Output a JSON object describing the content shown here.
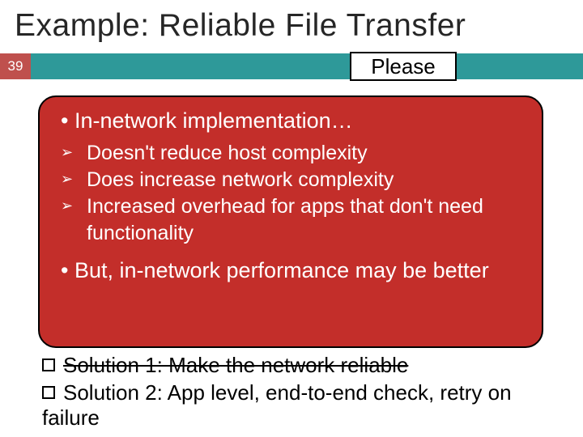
{
  "title": "Example: Reliable File Transfer",
  "slide_number": "39",
  "please_label": "Please",
  "callout": {
    "head1": "• In-network implementation…",
    "items": [
      "Doesn't reduce host complexity",
      "Does increase network complexity",
      "Increased overhead for apps that don't need functionality"
    ],
    "head2": "• But, in-network performance may be better"
  },
  "solutions": {
    "s1": "Solution 1: Make the network reliable",
    "s2": "Solution 2: App level, end-to-end check, retry on failure"
  }
}
